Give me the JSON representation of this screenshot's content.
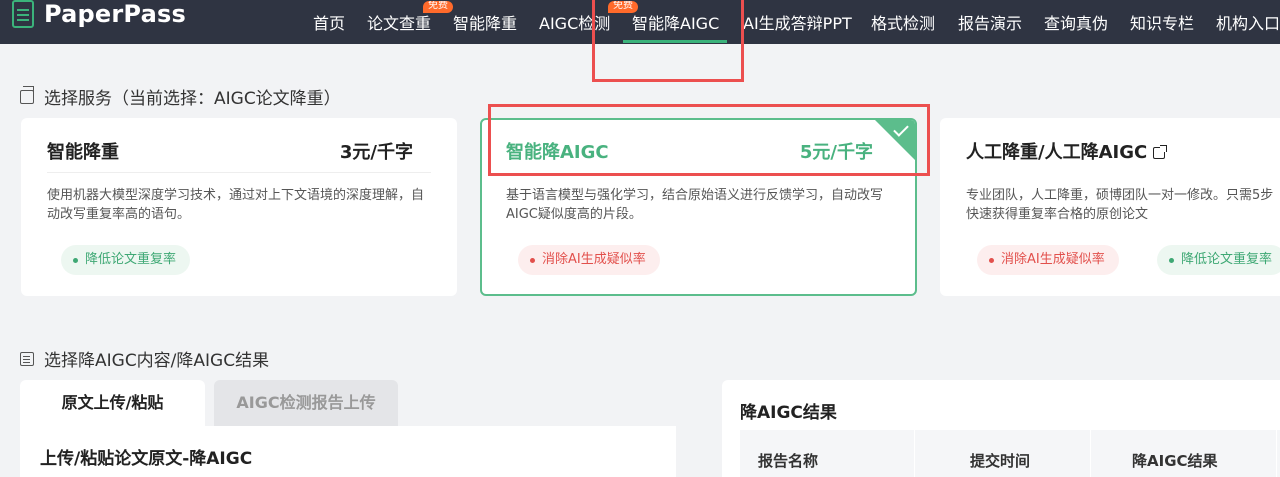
{
  "header": {
    "logo_text": "PaperPass",
    "nav": [
      {
        "label": "首页"
      },
      {
        "label": "论文查重",
        "badge": "免费"
      },
      {
        "label": "智能降重"
      },
      {
        "label": "AIGC检测"
      },
      {
        "label": "智能降AIGC",
        "badge": "免费",
        "active": true
      },
      {
        "label": "AI生成答辩PPT"
      },
      {
        "label": "格式检测"
      },
      {
        "label": "报告演示"
      },
      {
        "label": "查询真伪"
      },
      {
        "label": "知识专栏"
      },
      {
        "label": "机构入口"
      }
    ]
  },
  "service_section": {
    "title": "选择服务（当前选择：AIGC论文降重）",
    "cards": [
      {
        "title": "智能降重",
        "price": "3元/千字",
        "desc": "使用机器大模型深度学习技术，通过对上下文语境的深度理解，自动改写重复率高的语句。",
        "tags": [
          {
            "text": "降低论文重复率",
            "color": "green"
          }
        ]
      },
      {
        "title": "智能降AIGC",
        "price": "5元/千字",
        "selected": true,
        "desc": "基于语言模型与强化学习，结合原始语义进行反馈学习，自动改写AIGC疑似度高的片段。",
        "tags": [
          {
            "text": "消除AI生成疑似率",
            "color": "red"
          }
        ]
      },
      {
        "title": "人工降重/人工降AIGC",
        "desc_line1": "专业团队，人工降重，硕博团队一对一修改。只需5步",
        "desc_line2": "快速获得重复率合格的原创论文",
        "tags": [
          {
            "text": "消除AI生成疑似率",
            "color": "red"
          },
          {
            "text": "降低论文重复率",
            "color": "green"
          }
        ]
      }
    ]
  },
  "content_section": {
    "title": "选择降AIGC内容/降AIGC结果",
    "tabs": [
      {
        "label": "原文上传/粘贴",
        "active": true
      },
      {
        "label": "AIGC检测报告上传"
      }
    ],
    "upload_title": "上传/粘贴论文原文-降AIGC",
    "result": {
      "title": "降AIGC结果",
      "columns": [
        "报告名称",
        "提交时间",
        "降AIGC结果"
      ]
    }
  },
  "colors": {
    "nav_bg": "#2f3442",
    "accent_green": "#5cbd8c",
    "badge_orange": "#ff6a2b",
    "tag_red": "#e2504c",
    "highlight_red": "#ec4f4f"
  }
}
